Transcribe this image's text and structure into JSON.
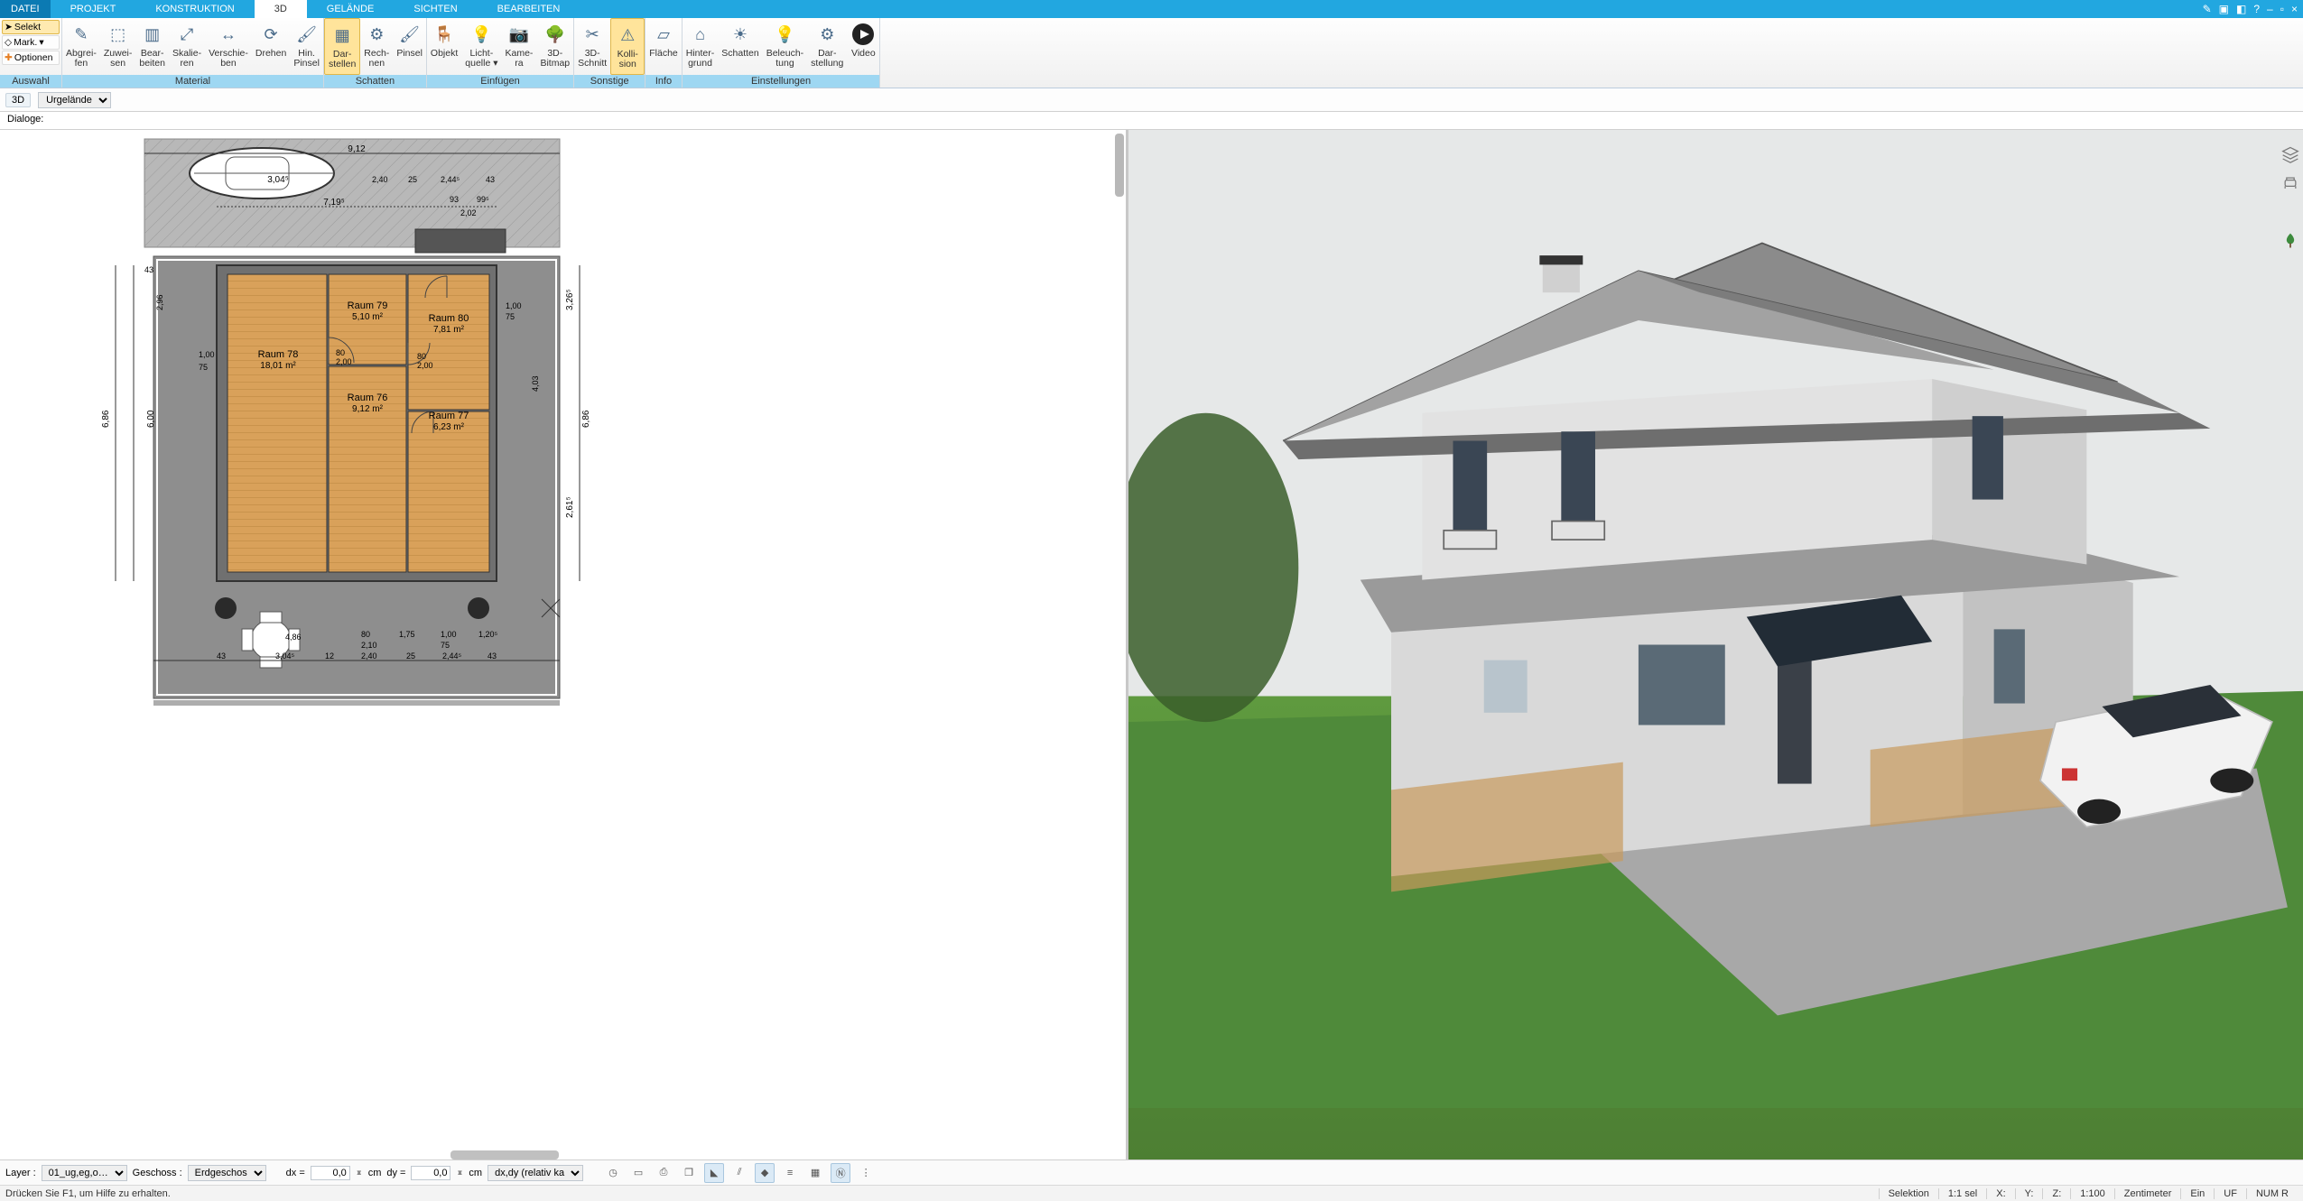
{
  "menu": {
    "tabs": [
      "DATEI",
      "PROJEKT",
      "KONSTRUKTION",
      "3D",
      "GELÄNDE",
      "SICHTEN",
      "BEARBEITEN"
    ],
    "active_index": 3
  },
  "ribbon": {
    "auswahl": {
      "label": "Auswahl",
      "selekt": "Selekt",
      "mark": "Mark.",
      "optionen": "Optionen"
    },
    "groups": [
      {
        "label": "Material",
        "items": [
          {
            "t1": "Abgrei-",
            "t2": "fen"
          },
          {
            "t1": "Zuwei-",
            "t2": "sen"
          },
          {
            "t1": "Bear-",
            "t2": "beiten"
          },
          {
            "t1": "Skalie-",
            "t2": "ren"
          },
          {
            "t1": "Verschie-",
            "t2": "ben"
          },
          {
            "t1": "Drehen",
            "t2": ""
          },
          {
            "t1": "Hin.",
            "t2": "Pinsel"
          }
        ]
      },
      {
        "label": "Schatten",
        "items": [
          {
            "t1": "Dar-",
            "t2": "stellen",
            "active": true
          },
          {
            "t1": "Rech-",
            "t2": "nen"
          },
          {
            "t1": "Pinsel",
            "t2": ""
          }
        ]
      },
      {
        "label": "Einfügen",
        "items": [
          {
            "t1": "Objekt",
            "t2": ""
          },
          {
            "t1": "Licht-",
            "t2": "quelle ▾"
          },
          {
            "t1": "Kame-",
            "t2": "ra"
          },
          {
            "t1": "3D-",
            "t2": "Bitmap"
          }
        ]
      },
      {
        "label": "Sonstige",
        "items": [
          {
            "t1": "3D-",
            "t2": "Schnitt"
          },
          {
            "t1": "Kolli-",
            "t2": "sion",
            "active": true
          }
        ]
      },
      {
        "label": "Info",
        "items": [
          {
            "t1": "Fläche",
            "t2": ""
          }
        ]
      },
      {
        "label": "Einstellungen",
        "items": [
          {
            "t1": "Hinter-",
            "t2": "grund"
          },
          {
            "t1": "Schatten",
            "t2": ""
          },
          {
            "t1": "Beleuch-",
            "t2": "tung"
          },
          {
            "t1": "Dar-",
            "t2": "stellung"
          },
          {
            "t1": "Video",
            "t2": ""
          }
        ]
      }
    ]
  },
  "secbar": {
    "mode": "3D",
    "layer": "Urgelände"
  },
  "dialoge_label": "Dialoge:",
  "plan": {
    "rooms": [
      {
        "name": "Raum 78",
        "area": "18,01 m²"
      },
      {
        "name": "Raum 79",
        "area": "5,10 m²"
      },
      {
        "name": "Raum 76",
        "area": "9,12 m²"
      },
      {
        "name": "Raum 80",
        "area": "7,81 m²"
      },
      {
        "name": "Raum 77",
        "area": "6,23 m²"
      }
    ],
    "dims": {
      "top_total": "9,12",
      "top_car": "3,04⁵",
      "top_span": "7,19⁵",
      "top_seg_a": "2,40",
      "top_seg_b": "25",
      "top_seg_c": "2,44⁵",
      "top_seg_d": "43",
      "top_r1": "93",
      "top_r2": "99⁵",
      "top_r3": "2,02",
      "left_total": "6,86",
      "left_inner": "6,00",
      "left_a": "43",
      "left_b": "2,96",
      "left_c": "1,00",
      "left_d": "75",
      "right_total": "6,86",
      "right_inner": "2,61⁵",
      "right_a": "3,26⁵",
      "right_b": "1,00",
      "right_c": "75",
      "right_d": "4,03",
      "bot_a": "43",
      "bot_b": "3,04⁵",
      "bot_c": "12",
      "bot_d": "2,40",
      "bot_e": "25",
      "bot_f": "2,44⁵",
      "bot_g": "43",
      "bot_row2_a": "4,86",
      "bot_row2_b": "80",
      "bot_row2_c": "1,75",
      "bot_row2_d": "1,00",
      "bot_row2_e": "1,20⁵",
      "bot_row3_a": "2,10",
      "bot_row3_b": "75",
      "door_a": "80",
      "door_b": "2,00",
      "door_c": "80",
      "door_d": "2,00"
    }
  },
  "ctrl": {
    "layer_label": "Layer :",
    "layer_value": "01_ug,eg,o…",
    "floor_label": "Geschoss :",
    "floor_value": "Erdgeschos",
    "dx_label": "dx =",
    "dx_value": "0,0",
    "dy_label": "dy =",
    "dy_value": "0,0",
    "unit": "cm",
    "mode": "dx,dy (relativ ka"
  },
  "status": {
    "help": "Drücken Sie F1, um Hilfe zu erhalten.",
    "selection": "Selektion",
    "sel_count": "1:1 sel",
    "x": "X:",
    "y": "Y:",
    "z": "Z:",
    "scale": "1:100",
    "unit": "Zentimeter",
    "ein": "Ein",
    "uf": "UF",
    "num": "NUM R"
  }
}
